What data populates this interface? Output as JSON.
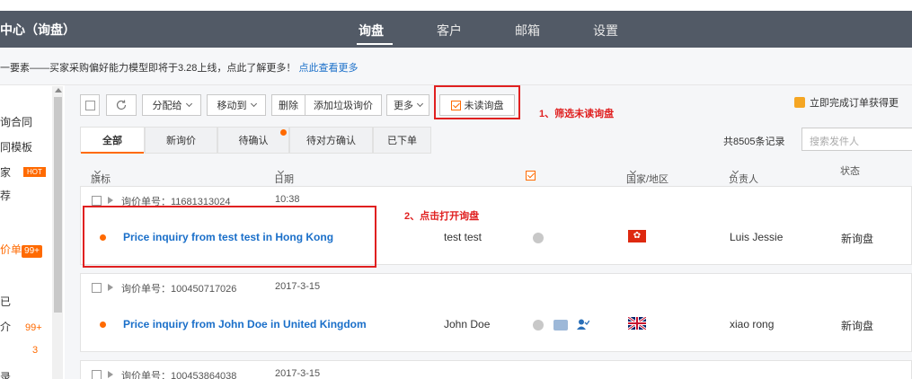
{
  "nav": {
    "brand": "中心（询盘）",
    "items": [
      "询盘",
      "客户",
      "邮箱",
      "设置"
    ]
  },
  "notice": {
    "text": "一要素——买家采购偏好能力模型即将于3.28上线，点此了解更多！",
    "link": "点此查看更多"
  },
  "sidebar": {
    "items": [
      "询合同",
      "同模板",
      "家",
      "荐",
      "价单",
      "已",
      "介",
      "",
      "录"
    ],
    "hot": "HOT",
    "badge": "99+",
    "count1": "99+",
    "count2": "3"
  },
  "toolbar": {
    "assign": "分配给",
    "move": "移动到",
    "delete": "删除",
    "spam": "添加垃圾询价",
    "more": "更多",
    "unread": "未读询盘",
    "promo": "立即完成订单获得更"
  },
  "annotations": {
    "step1": "1、筛选未读询盘",
    "step2": "2、点击打开询盘"
  },
  "tabs": [
    "全部",
    "新询价",
    "待确认",
    "待对方确认",
    "已下单"
  ],
  "total": "共8505条记录",
  "search_placeholder": "搜索发件人",
  "columns": {
    "flag": "旗标",
    "date": "日期",
    "country": "国家/地区",
    "owner": "负责人",
    "status": "状态"
  },
  "inquiries": [
    {
      "number": "询价单号：11681313024",
      "time": "10:38",
      "title": "Price inquiry from test test in Hong Kong",
      "sender": "test test",
      "country": "Hong Kong",
      "owner": "Luis Jessie",
      "status": "新询盘"
    },
    {
      "number": "询价单号：100450717026",
      "time": "2017-3-15",
      "title": "Price inquiry from John Doe in United Kingdom",
      "sender": "John Doe",
      "country": "United Kingdom",
      "owner": "xiao rong",
      "status": "新询盘"
    },
    {
      "number": "询价单号：100453864038",
      "time": "2017-3-15"
    }
  ],
  "colors": {
    "nav_bg": "#525a66",
    "accent": "#ff6a00",
    "link": "#1a6fc9",
    "annotation": "#e02020"
  }
}
